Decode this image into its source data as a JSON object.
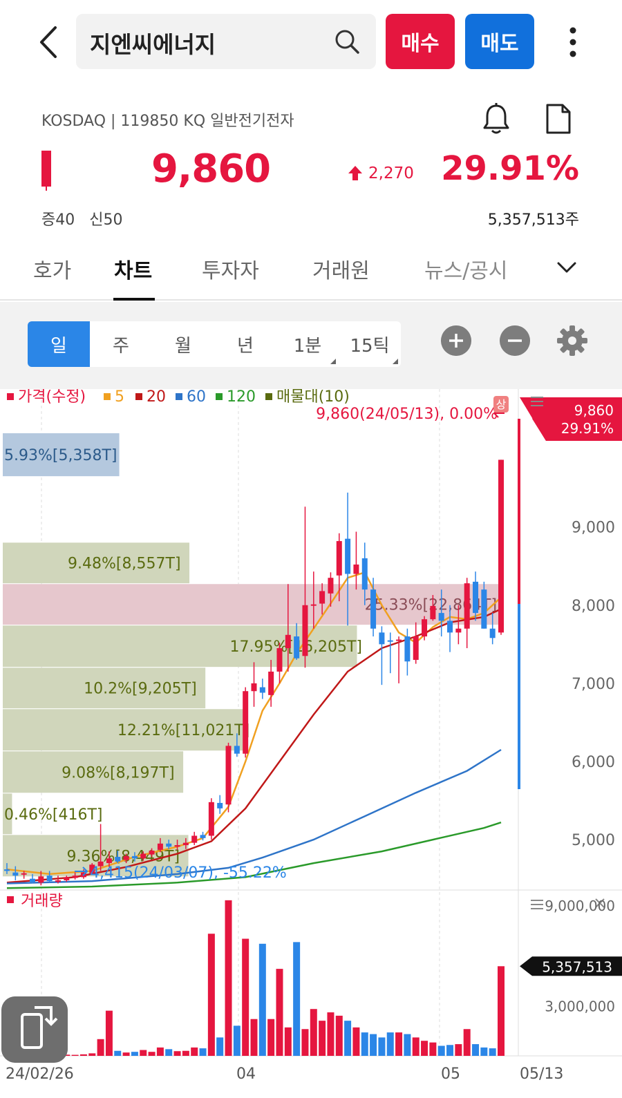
{
  "header": {
    "stock_name": "지엔씨에너지",
    "buy_label": "매수",
    "sell_label": "매도"
  },
  "stock": {
    "market_line": "KOSDAQ | 119850 KQ 일반전기전자",
    "price": "9,860",
    "change": "2,270",
    "change_pct": "29.91%",
    "credit_info": "증40   신50",
    "volume": "5,357,513주"
  },
  "tabs": [
    "호가",
    "차트",
    "투자자",
    "거래원",
    "뉴스/공시"
  ],
  "periods": [
    "일",
    "주",
    "월",
    "년",
    "1분",
    "15틱"
  ],
  "colors": {
    "up": "#e5163f",
    "down": "#2b86e7",
    "ma5": "#f0a020",
    "ma20": "#c01818",
    "ma60": "#2e74c8",
    "ma120": "#2a9a2a",
    "profile": "#5a6b10"
  },
  "chart_data": {
    "type": "candlestick",
    "legend": [
      "가격(수정)",
      "5",
      "20",
      "60",
      "120",
      "매물대(10)"
    ],
    "last_label": "9,860(24/05/13), 0.00%",
    "low_label": "4,415(24/03/07), -55.22%",
    "current_price_tag": "9,860",
    "current_pct_tag": "29.91%",
    "limit_badge": "상",
    "ylim": [
      4400,
      10500
    ],
    "y_ticks": [
      {
        "v": 9000,
        "label": "9,000"
      },
      {
        "v": 8000,
        "label": "8,000"
      },
      {
        "v": 7000,
        "label": "7,000"
      },
      {
        "v": 6000,
        "label": "6,000"
      },
      {
        "v": 5000,
        "label": "5,000"
      }
    ],
    "x_labels": [
      "24/02/26",
      "04",
      "05",
      "05/13"
    ],
    "volume_profile": [
      {
        "label": "5.93%[5,358T]",
        "lo": 9650,
        "hi": 10200,
        "frac": 0.226,
        "kind": "current"
      },
      {
        "label": "9.48%[8,557T]",
        "lo": 8280,
        "hi": 8800,
        "frac": 0.362,
        "kind": "normal"
      },
      {
        "label": "25.33%[22,864T]",
        "lo": 7750,
        "hi": 8270,
        "frac": 0.97,
        "kind": "max"
      },
      {
        "label": "17.95%[16,205T]",
        "lo": 7210,
        "hi": 7740,
        "frac": 0.687,
        "kind": "normal"
      },
      {
        "label": "10.2%[9,205T]",
        "lo": 6680,
        "hi": 7200,
        "frac": 0.393,
        "kind": "normal"
      },
      {
        "label": "12.21%[11,021T]",
        "lo": 6140,
        "hi": 6670,
        "frac": 0.469,
        "kind": "normal"
      },
      {
        "label": "9.08%[8,197T]",
        "lo": 5600,
        "hi": 6130,
        "frac": 0.35,
        "kind": "normal"
      },
      {
        "label": "0.46%[416T]",
        "lo": 5070,
        "hi": 5590,
        "frac": 0.018,
        "kind": "normal"
      },
      {
        "label": "9.36%[8,449T]",
        "lo": 4530,
        "hi": 5060,
        "frac": 0.36,
        "kind": "normal"
      }
    ],
    "candles": [
      {
        "o": 4620,
        "h": 4700,
        "l": 4560,
        "c": 4600
      },
      {
        "o": 4580,
        "h": 4660,
        "l": 4480,
        "c": 4540
      },
      {
        "o": 4560,
        "h": 4600,
        "l": 4500,
        "c": 4570
      },
      {
        "o": 4500,
        "h": 4560,
        "l": 4440,
        "c": 4460
      },
      {
        "o": 4450,
        "h": 4600,
        "l": 4415,
        "c": 4530
      },
      {
        "o": 4540,
        "h": 4600,
        "l": 4450,
        "c": 4470
      },
      {
        "o": 4460,
        "h": 4540,
        "l": 4440,
        "c": 4480
      },
      {
        "o": 4480,
        "h": 4540,
        "l": 4460,
        "c": 4520
      },
      {
        "o": 4510,
        "h": 4580,
        "l": 4490,
        "c": 4540
      },
      {
        "o": 4520,
        "h": 4620,
        "l": 4500,
        "c": 4580
      },
      {
        "o": 4570,
        "h": 4700,
        "l": 4550,
        "c": 4680
      },
      {
        "o": 4660,
        "h": 5200,
        "l": 4600,
        "c": 4720
      },
      {
        "o": 4700,
        "h": 4850,
        "l": 4650,
        "c": 4760
      },
      {
        "o": 4780,
        "h": 4860,
        "l": 4700,
        "c": 4720
      },
      {
        "o": 4740,
        "h": 4820,
        "l": 4700,
        "c": 4790
      },
      {
        "o": 4790,
        "h": 4840,
        "l": 4720,
        "c": 4760
      },
      {
        "o": 4760,
        "h": 4850,
        "l": 4730,
        "c": 4820
      },
      {
        "o": 4810,
        "h": 4890,
        "l": 4780,
        "c": 4860
      },
      {
        "o": 4870,
        "h": 5020,
        "l": 4840,
        "c": 4950
      },
      {
        "o": 4950,
        "h": 5000,
        "l": 4880,
        "c": 4910
      },
      {
        "o": 4910,
        "h": 5000,
        "l": 4870,
        "c": 4930
      },
      {
        "o": 4930,
        "h": 5020,
        "l": 4880,
        "c": 4960
      },
      {
        "o": 4960,
        "h": 5100,
        "l": 4930,
        "c": 5050
      },
      {
        "o": 5060,
        "h": 5100,
        "l": 4990,
        "c": 5020
      },
      {
        "o": 5050,
        "h": 5530,
        "l": 5000,
        "c": 5480
      },
      {
        "o": 5470,
        "h": 5570,
        "l": 5330,
        "c": 5400
      },
      {
        "o": 5450,
        "h": 6240,
        "l": 5350,
        "c": 6200
      },
      {
        "o": 6200,
        "h": 6360,
        "l": 6060,
        "c": 6100
      },
      {
        "o": 6100,
        "h": 6950,
        "l": 6050,
        "c": 6900
      },
      {
        "o": 6900,
        "h": 7270,
        "l": 6700,
        "c": 7000
      },
      {
        "o": 6950,
        "h": 7060,
        "l": 6800,
        "c": 6880
      },
      {
        "o": 6850,
        "h": 7300,
        "l": 6700,
        "c": 7150
      },
      {
        "o": 7150,
        "h": 7520,
        "l": 7000,
        "c": 7450
      },
      {
        "o": 7450,
        "h": 8270,
        "l": 7150,
        "c": 7620
      },
      {
        "o": 7600,
        "h": 7770,
        "l": 7300,
        "c": 7320
      },
      {
        "o": 7350,
        "h": 9260,
        "l": 7200,
        "c": 8000
      },
      {
        "o": 8000,
        "h": 8430,
        "l": 7700,
        "c": 8010
      },
      {
        "o": 8020,
        "h": 8280,
        "l": 7880,
        "c": 8180
      },
      {
        "o": 8150,
        "h": 8420,
        "l": 7980,
        "c": 8350
      },
      {
        "o": 8380,
        "h": 8920,
        "l": 8050,
        "c": 8820
      },
      {
        "o": 8850,
        "h": 9440,
        "l": 7740,
        "c": 8400
      },
      {
        "o": 8400,
        "h": 8940,
        "l": 8200,
        "c": 8520
      },
      {
        "o": 8600,
        "h": 8800,
        "l": 8000,
        "c": 8200
      },
      {
        "o": 8200,
        "h": 8350,
        "l": 7600,
        "c": 7700
      },
      {
        "o": 7650,
        "h": 7730,
        "l": 6980,
        "c": 7500
      },
      {
        "o": 7550,
        "h": 7650,
        "l": 7130,
        "c": 7540
      },
      {
        "o": 7560,
        "h": 7600,
        "l": 7000,
        "c": 7560
      },
      {
        "o": 7600,
        "h": 7700,
        "l": 7100,
        "c": 7280
      },
      {
        "o": 7300,
        "h": 7780,
        "l": 7250,
        "c": 7600
      },
      {
        "o": 7600,
        "h": 7860,
        "l": 7550,
        "c": 7820
      },
      {
        "o": 7820,
        "h": 8130,
        "l": 7800,
        "c": 7990
      },
      {
        "o": 7900,
        "h": 8200,
        "l": 7600,
        "c": 7800
      },
      {
        "o": 7800,
        "h": 8000,
        "l": 7400,
        "c": 7650
      },
      {
        "o": 7650,
        "h": 8000,
        "l": 7500,
        "c": 7700
      },
      {
        "o": 7700,
        "h": 8350,
        "l": 7450,
        "c": 8280
      },
      {
        "o": 8300,
        "h": 8430,
        "l": 7800,
        "c": 7900
      },
      {
        "o": 8200,
        "h": 8300,
        "l": 7700,
        "c": 7700
      },
      {
        "o": 7700,
        "h": 7900,
        "l": 7500,
        "c": 7580
      },
      {
        "o": 7650,
        "h": 9860,
        "l": 7620,
        "c": 9860
      }
    ],
    "ma_series": [
      {
        "name": "5",
        "color": "#f0a020",
        "points": [
          [
            0,
            4620
          ],
          [
            5,
            4560
          ],
          [
            10,
            4600
          ],
          [
            15,
            4780
          ],
          [
            20,
            4910
          ],
          [
            23,
            5020
          ],
          [
            26,
            5420
          ],
          [
            28,
            6000
          ],
          [
            30,
            6650
          ],
          [
            32,
            7000
          ],
          [
            34,
            7380
          ],
          [
            36,
            7700
          ],
          [
            38,
            8020
          ],
          [
            40,
            8350
          ],
          [
            42,
            8420
          ],
          [
            44,
            8000
          ],
          [
            46,
            7650
          ],
          [
            48,
            7520
          ],
          [
            50,
            7720
          ],
          [
            52,
            7850
          ],
          [
            54,
            7820
          ],
          [
            56,
            7900
          ],
          [
            58,
            8100
          ]
        ]
      },
      {
        "name": "20",
        "color": "#c01818",
        "points": [
          [
            0,
            4450
          ],
          [
            8,
            4520
          ],
          [
            14,
            4650
          ],
          [
            20,
            4820
          ],
          [
            24,
            4980
          ],
          [
            28,
            5400
          ],
          [
            32,
            6000
          ],
          [
            36,
            6600
          ],
          [
            40,
            7150
          ],
          [
            44,
            7450
          ],
          [
            48,
            7600
          ],
          [
            52,
            7780
          ],
          [
            56,
            7850
          ],
          [
            58,
            7950
          ]
        ]
      },
      {
        "name": "60",
        "color": "#2e74c8",
        "points": [
          [
            0,
            4440
          ],
          [
            10,
            4470
          ],
          [
            20,
            4560
          ],
          [
            26,
            4640
          ],
          [
            30,
            4770
          ],
          [
            36,
            5000
          ],
          [
            42,
            5300
          ],
          [
            48,
            5600
          ],
          [
            54,
            5880
          ],
          [
            58,
            6150
          ]
        ]
      },
      {
        "name": "120",
        "color": "#2a9a2a",
        "points": [
          [
            0,
            4380
          ],
          [
            10,
            4400
          ],
          [
            20,
            4450
          ],
          [
            28,
            4520
          ],
          [
            36,
            4700
          ],
          [
            44,
            4850
          ],
          [
            50,
            5000
          ],
          [
            56,
            5150
          ],
          [
            58,
            5220
          ]
        ]
      }
    ],
    "volume_title": "거래량",
    "volume_last_tag": "5,357,513",
    "volume_ticks": [
      {
        "v": 9000000,
        "label": "9,000,000"
      },
      {
        "v": 3000000,
        "label": "3,000,000"
      }
    ],
    "volume_ylim": [
      0,
      9500000
    ],
    "volumes": [
      60000,
      50000,
      40000,
      60000,
      80000,
      90000,
      70000,
      60000,
      90000,
      150000,
      1000000,
      2700000,
      300000,
      200000,
      240000,
      350000,
      240000,
      500000,
      400000,
      280000,
      300000,
      500000,
      450000,
      7300000,
      1100000,
      9300000,
      1800000,
      7000000,
      2200000,
      6700000,
      2200000,
      5200000,
      1700000,
      6800000,
      1600000,
      2800000,
      2100000,
      2600000,
      2400000,
      2100000,
      1700000,
      1400000,
      1300000,
      1100000,
      1400000,
      1400000,
      1300000,
      1100000,
      900000,
      800000,
      600000,
      650000,
      700000,
      1600000,
      700000,
      500000,
      450000,
      5357513
    ]
  }
}
